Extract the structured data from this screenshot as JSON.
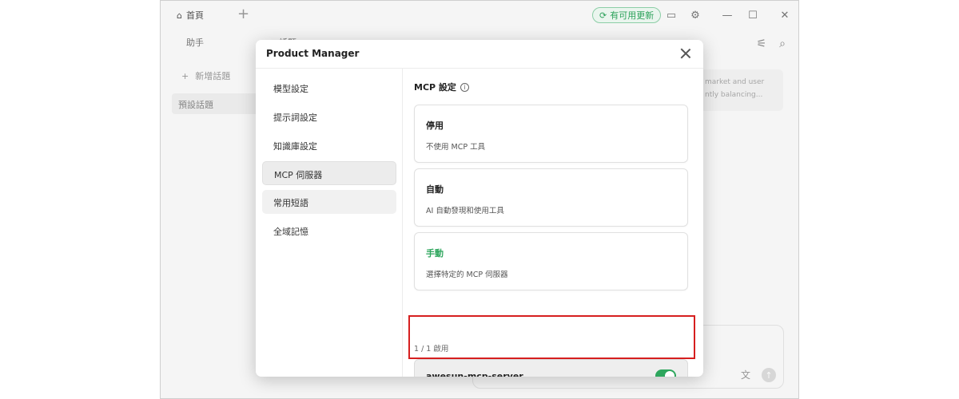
{
  "app": {
    "home_tab": "首頁",
    "update_label": "有可用更新",
    "sidebar_tabs": [
      "助手",
      "話題"
    ],
    "new_topic": "新增話題",
    "preset_topic": "預設話題",
    "bg_card_lines": [
      "market and user",
      "ntly balancing..."
    ]
  },
  "modal": {
    "title": "Product Manager",
    "nav": [
      {
        "label": "模型設定"
      },
      {
        "label": "提示詞設定"
      },
      {
        "label": "知識庫設定"
      },
      {
        "label": "MCP 伺服器"
      },
      {
        "label": "常用短語"
      },
      {
        "label": "全域記憶"
      }
    ],
    "active_nav": "MCP 伺服器",
    "section_title": "MCP 設定",
    "options": [
      {
        "title": "停用",
        "desc": "不使用 MCP 工具"
      },
      {
        "title": "自動",
        "desc": "AI 自動發現和使用工具"
      },
      {
        "title": "手動",
        "desc": "選擇特定的 MCP 伺服器"
      }
    ],
    "selected_option": "手動",
    "enabled_count": "1 / 1 啟用",
    "server": {
      "name": "awesun-mcp-server",
      "enabled": true
    }
  },
  "colors": {
    "accent": "#2ea65d",
    "highlight": "#d61f1f"
  }
}
